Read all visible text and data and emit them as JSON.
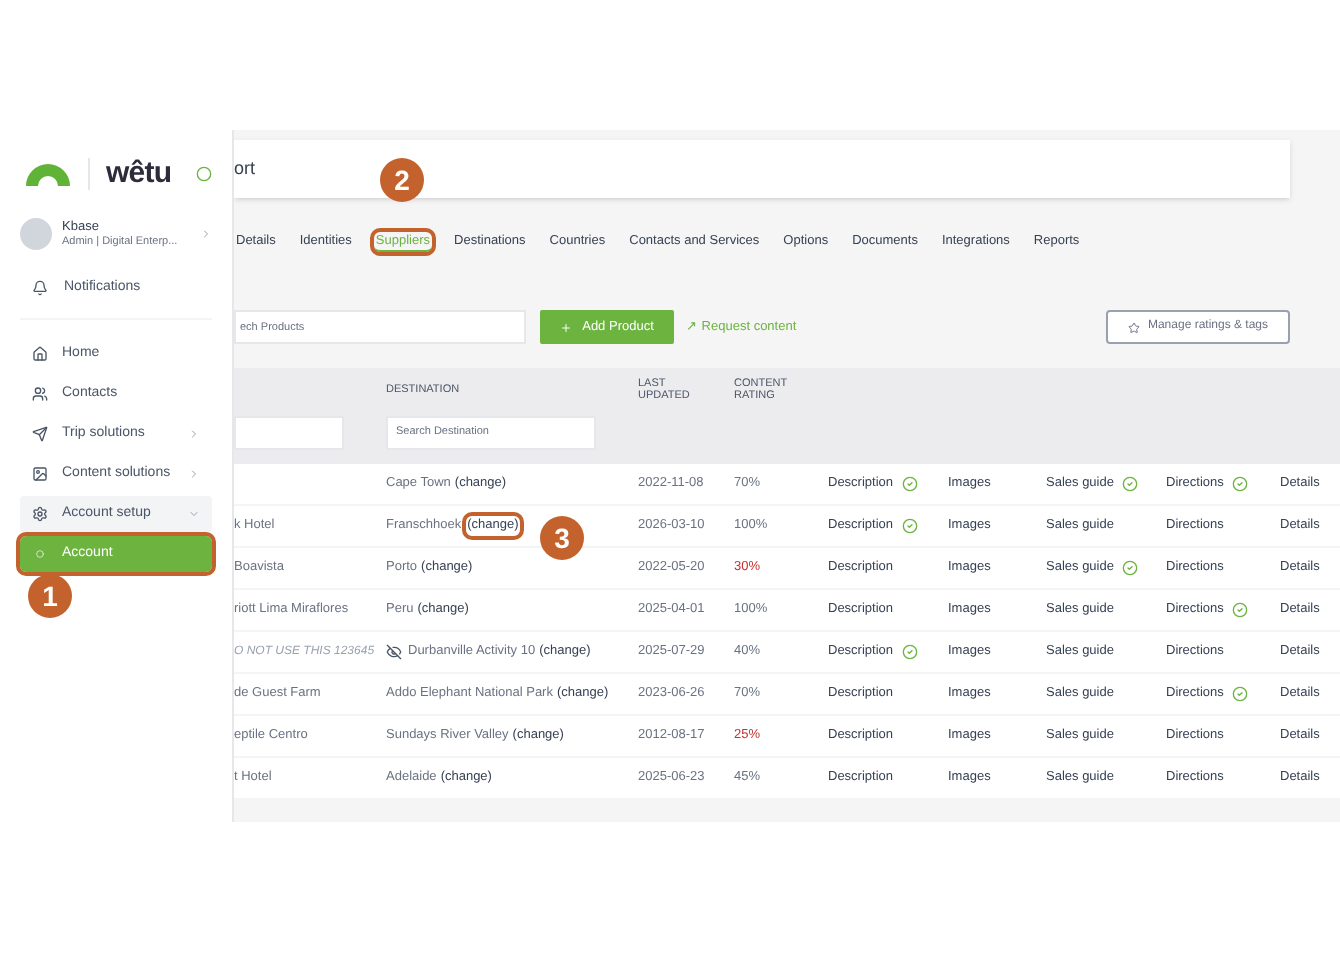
{
  "sidebar": {
    "logo": "wêtu",
    "profile": {
      "name": "Kbase",
      "role": "Admin | Digital Enterp..."
    },
    "notifications": "Notifications",
    "items": [
      {
        "label": "Home",
        "kind": "link",
        "selected": false,
        "highlighted": false
      },
      {
        "label": "Contacts",
        "kind": "link",
        "selected": false,
        "highlighted": false
      },
      {
        "label": "Trip solutions",
        "kind": "menu",
        "selected": false,
        "highlighted": false
      },
      {
        "label": "Content solutions",
        "kind": "menu",
        "selected": false,
        "highlighted": false
      },
      {
        "label": "Account setup",
        "kind": "group",
        "selected": false,
        "highlighted": false
      },
      {
        "label": "Account",
        "kind": "child",
        "selected": true,
        "highlighted": true
      }
    ]
  },
  "header": {
    "title": "ort"
  },
  "tabs": [
    {
      "label": "Details",
      "selected": false,
      "highlighted": false
    },
    {
      "label": "Identities",
      "selected": false,
      "highlighted": false
    },
    {
      "label": "Suppliers",
      "selected": true,
      "highlighted": true
    },
    {
      "label": "Destinations",
      "selected": false,
      "highlighted": false
    },
    {
      "label": "Countries",
      "selected": false,
      "highlighted": false
    },
    {
      "label": "Contacts and Services",
      "selected": false,
      "highlighted": false
    },
    {
      "label": "Options",
      "selected": false,
      "highlighted": false
    },
    {
      "label": "Documents",
      "selected": false,
      "highlighted": false
    },
    {
      "label": "Integrations",
      "selected": false,
      "highlighted": false
    },
    {
      "label": "Reports",
      "selected": false,
      "highlighted": false
    }
  ],
  "toolbar": {
    "search": {
      "placeholder": "ech Products"
    },
    "add_button": "Add Product",
    "request_link": "↗ Request content",
    "manage_button": "Manage ratings & tags"
  },
  "table": {
    "columns": [
      "DESTINATION",
      "LAST UPDATED",
      "CONTENT RATING"
    ],
    "destination_search": {
      "placeholder": "Search Destination"
    },
    "rows": [
      {
        "name": "",
        "hidden": false,
        "destination": "Cape Town",
        "change": "(change)",
        "change_highlighted": false,
        "updated": "2022-11-08",
        "rating": "70%",
        "rating_low": false,
        "description": "Description",
        "description_done": true,
        "images": "Images",
        "sales_guide": "Sales guide",
        "sales_guide_done": true,
        "directions": "Directions",
        "directions_done": true,
        "details": "Details"
      },
      {
        "name": "k Hotel",
        "hidden": false,
        "destination": "Franschhoek",
        "change": "(change)",
        "change_highlighted": true,
        "updated": "2026-03-10",
        "rating": "100%",
        "rating_low": false,
        "description": "Description",
        "description_done": true,
        "images": "Images",
        "sales_guide": "Sales guide",
        "sales_guide_done": false,
        "directions": "Directions",
        "directions_done": false,
        "details": "Details"
      },
      {
        "name": "Boavista",
        "hidden": false,
        "destination": "Porto",
        "change": "(change)",
        "change_highlighted": false,
        "updated": "2022-05-20",
        "rating": "30%",
        "rating_low": true,
        "description": "Description",
        "description_done": false,
        "images": "Images",
        "sales_guide": "Sales guide",
        "sales_guide_done": true,
        "directions": "Directions",
        "directions_done": false,
        "details": "Details"
      },
      {
        "name": "riott Lima Miraflores",
        "hidden": false,
        "destination": "Peru",
        "change": "(change)",
        "change_highlighted": false,
        "updated": "2025-04-01",
        "rating": "100%",
        "rating_low": false,
        "description": "Description",
        "description_done": false,
        "images": "Images",
        "sales_guide": "Sales guide",
        "sales_guide_done": false,
        "directions": "Directions",
        "directions_done": true,
        "details": "Details"
      },
      {
        "name": "O NOT USE THIS 123645",
        "hidden": true,
        "destination": "Durbanville Activity 10",
        "change": "(change)",
        "change_highlighted": false,
        "updated": "2025-07-29",
        "rating": "40%",
        "rating_low": false,
        "description": "Description",
        "description_done": true,
        "images": "Images",
        "sales_guide": "Sales guide",
        "sales_guide_done": false,
        "directions": "Directions",
        "directions_done": false,
        "details": "Details"
      },
      {
        "name": "de Guest Farm",
        "hidden": false,
        "destination": "Addo Elephant National Park",
        "change": "(change)",
        "change_highlighted": false,
        "updated": "2023-06-26",
        "rating": "70%",
        "rating_low": false,
        "description": "Description",
        "description_done": false,
        "images": "Images",
        "sales_guide": "Sales guide",
        "sales_guide_done": false,
        "directions": "Directions",
        "directions_done": true,
        "details": "Details"
      },
      {
        "name": "eptile Centro",
        "hidden": false,
        "destination": "Sundays River Valley",
        "change": "(change)",
        "change_highlighted": false,
        "updated": "2012-08-17",
        "rating": "25%",
        "rating_low": true,
        "description": "Description",
        "description_done": false,
        "images": "Images",
        "sales_guide": "Sales guide",
        "sales_guide_done": false,
        "directions": "Directions",
        "directions_done": false,
        "details": "Details"
      },
      {
        "name": "t Hotel",
        "hidden": false,
        "destination": "Adelaide",
        "change": "(change)",
        "change_highlighted": false,
        "updated": "2025-06-23",
        "rating": "45%",
        "rating_low": false,
        "description": "Description",
        "description_done": false,
        "images": "Images",
        "sales_guide": "Sales guide",
        "sales_guide_done": false,
        "directions": "Directions",
        "directions_done": false,
        "details": "Details"
      }
    ]
  },
  "annotations": [
    {
      "label": "1"
    },
    {
      "label": "2"
    },
    {
      "label": "3"
    }
  ]
}
